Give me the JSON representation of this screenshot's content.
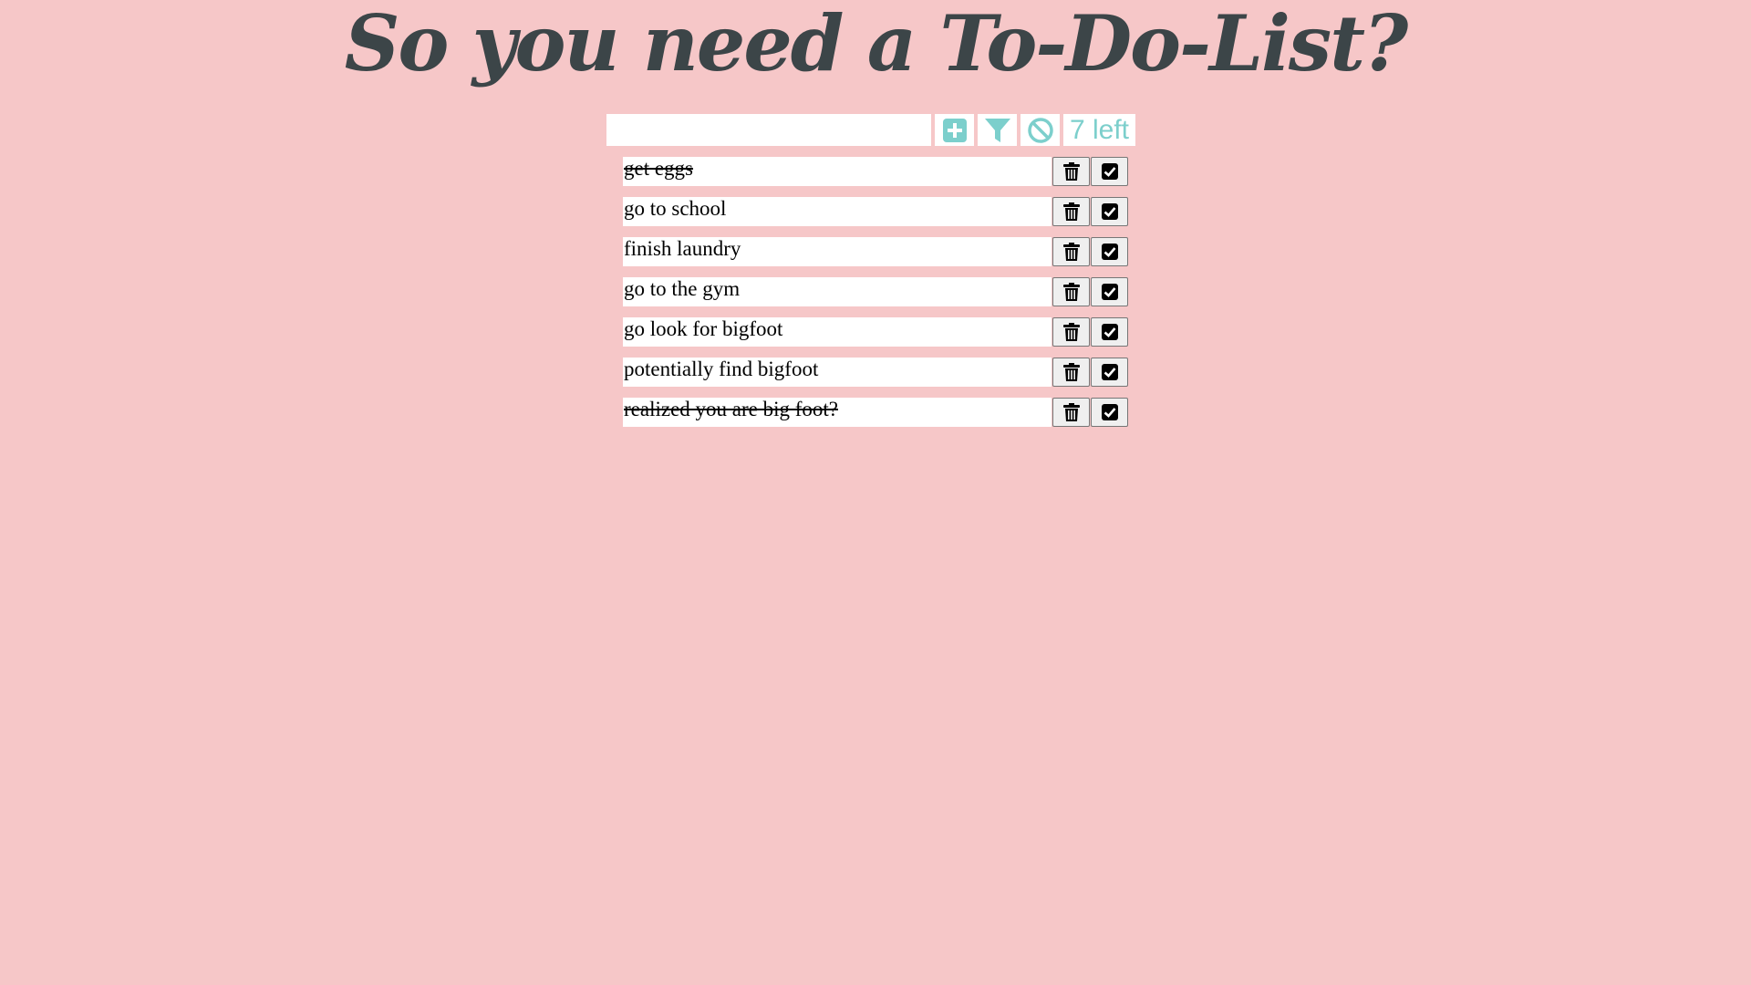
{
  "header": {
    "title": "So you need a To-Do-List?"
  },
  "toolbar": {
    "input_value": "",
    "input_placeholder": "",
    "add_icon": "plus-square-icon",
    "filter_icon": "filter-icon",
    "clear_icon": "ban-icon",
    "counter_label": "7 left",
    "accent_color": "#7ccfcc"
  },
  "todos": [
    {
      "text": "get eggs",
      "done": true
    },
    {
      "text": "go to school",
      "done": false
    },
    {
      "text": "finish laundry",
      "done": false
    },
    {
      "text": "go to the gym",
      "done": false
    },
    {
      "text": "go look for bigfoot",
      "done": false
    },
    {
      "text": "potentially find bigfoot",
      "done": false
    },
    {
      "text": "realized you are big foot?",
      "done": true
    }
  ],
  "item_icons": {
    "delete": "trash-icon",
    "complete": "check-square-icon"
  },
  "colors": {
    "background": "#f6c7c8",
    "title": "#3c4548"
  }
}
